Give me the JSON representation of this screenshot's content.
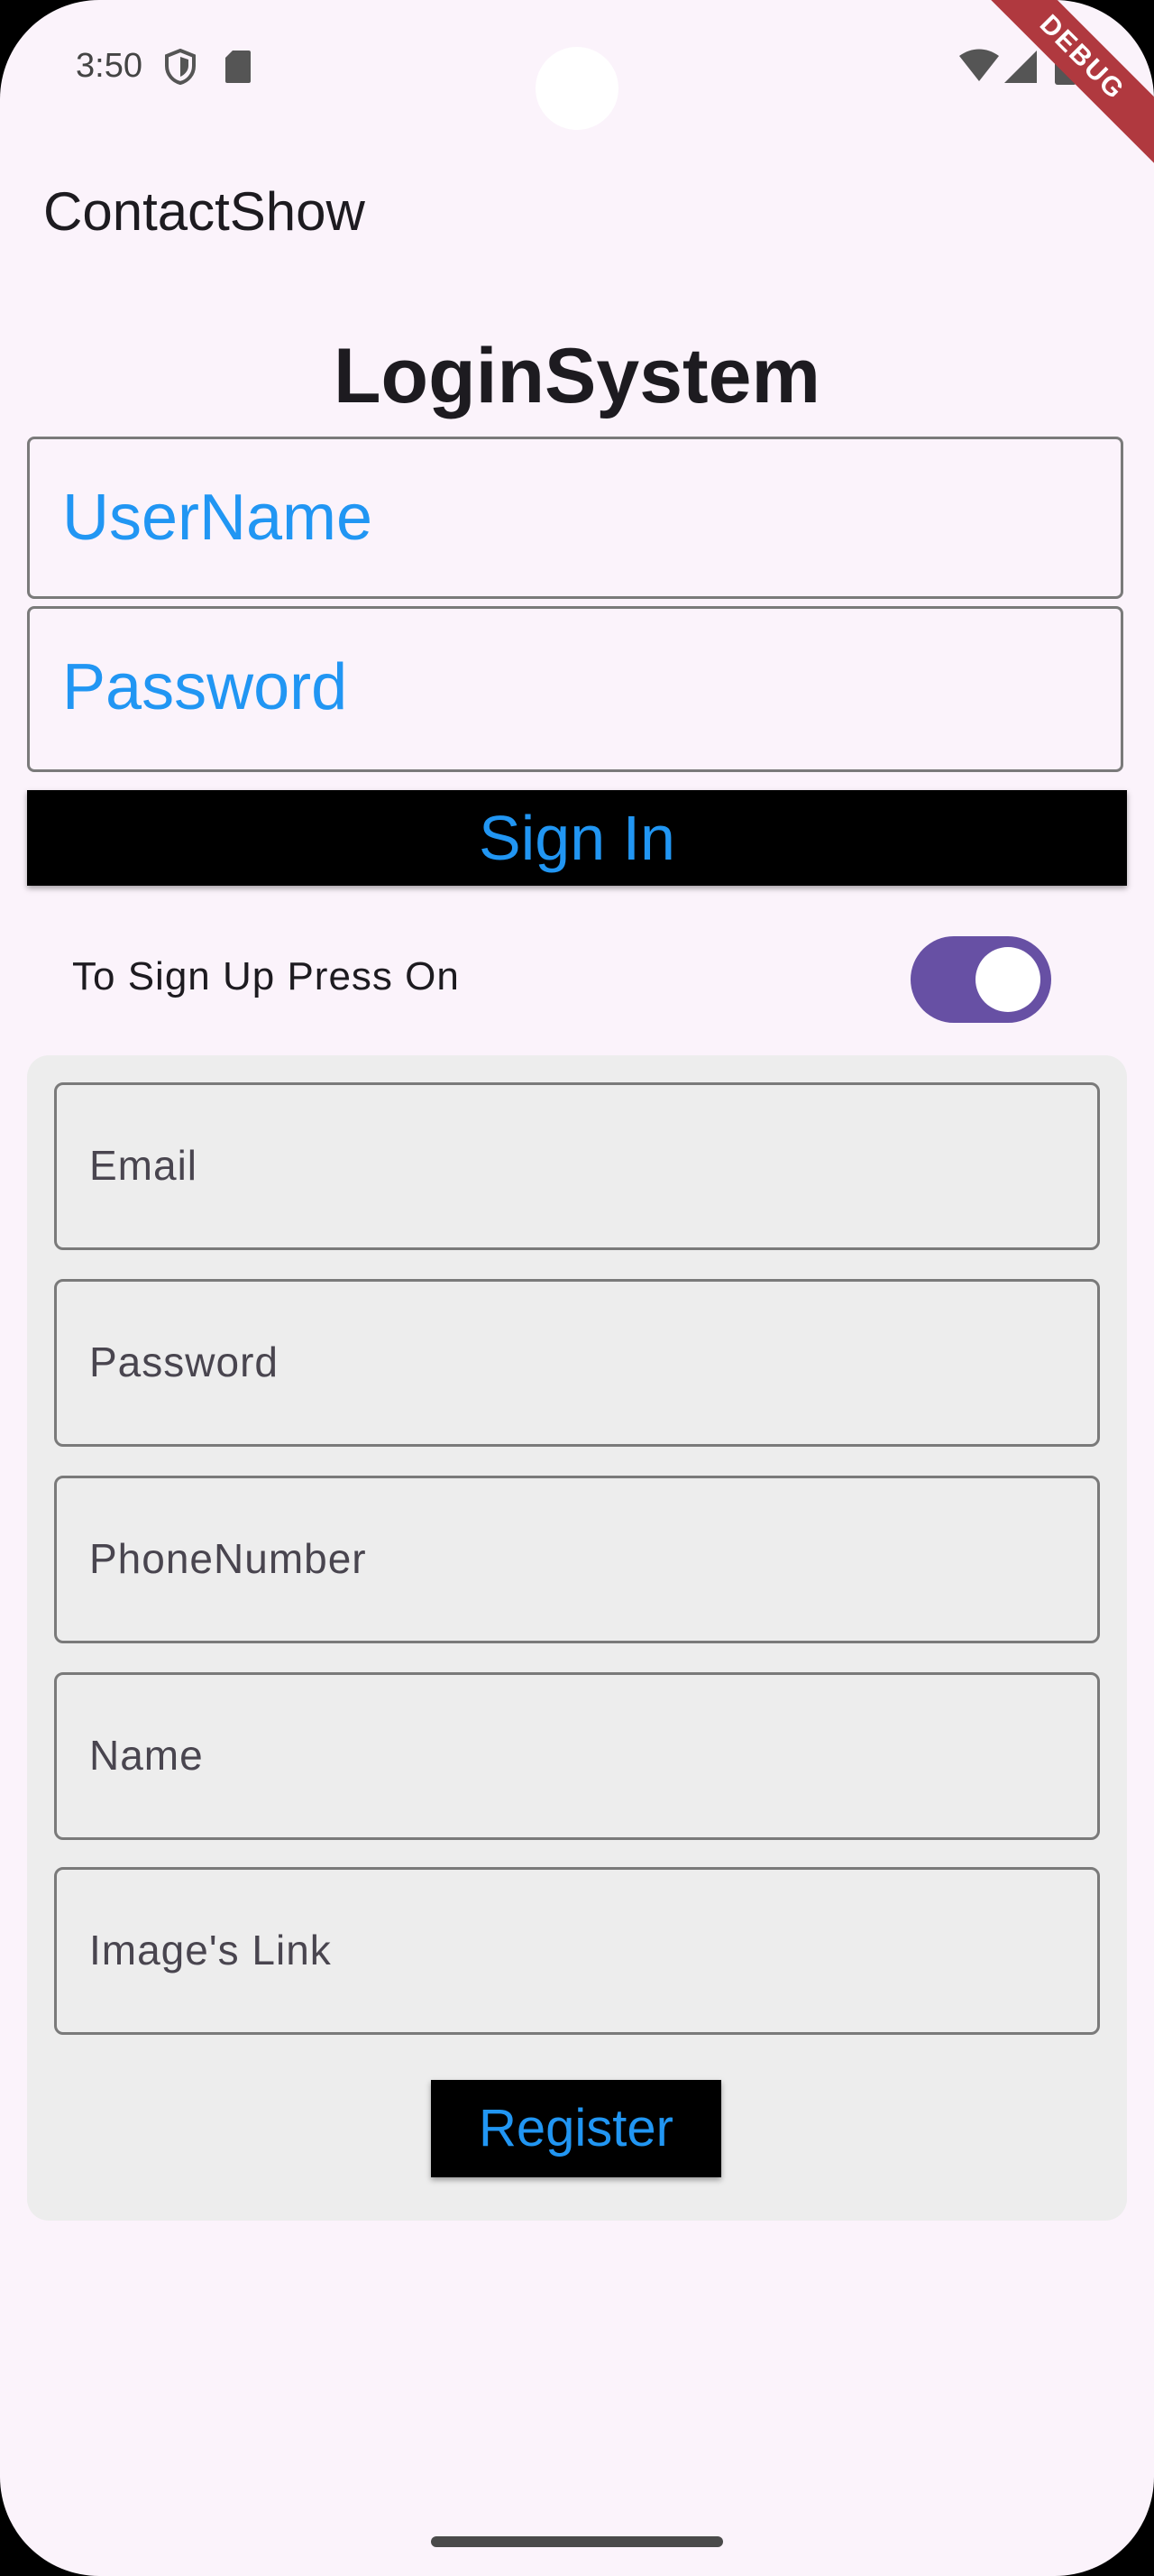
{
  "status_bar": {
    "time": "3:50",
    "debug_label": "DEBUG",
    "icons": [
      "shield-icon",
      "sd-card-icon",
      "wifi-icon",
      "cell-signal-icon",
      "battery-icon"
    ]
  },
  "app_bar": {
    "title": "ContactShow"
  },
  "login": {
    "title": "LoginSystem",
    "username_placeholder": "UserName",
    "password_placeholder": "Password",
    "signin_label": "Sign In"
  },
  "signup_toggle": {
    "label": "To Sign Up Press On",
    "value": true
  },
  "signup": {
    "email_placeholder": "Email",
    "password_placeholder": "Password",
    "phone_placeholder": "PhoneNumber",
    "name_placeholder": "Name",
    "image_link_placeholder": "Image's Link",
    "register_label": "Register"
  },
  "colors": {
    "background": "#fbf3fb",
    "accent_text": "#2196f3",
    "switch_track": "#6750a4",
    "card_background": "#ededed",
    "debug_ribbon": "#b0393f"
  }
}
